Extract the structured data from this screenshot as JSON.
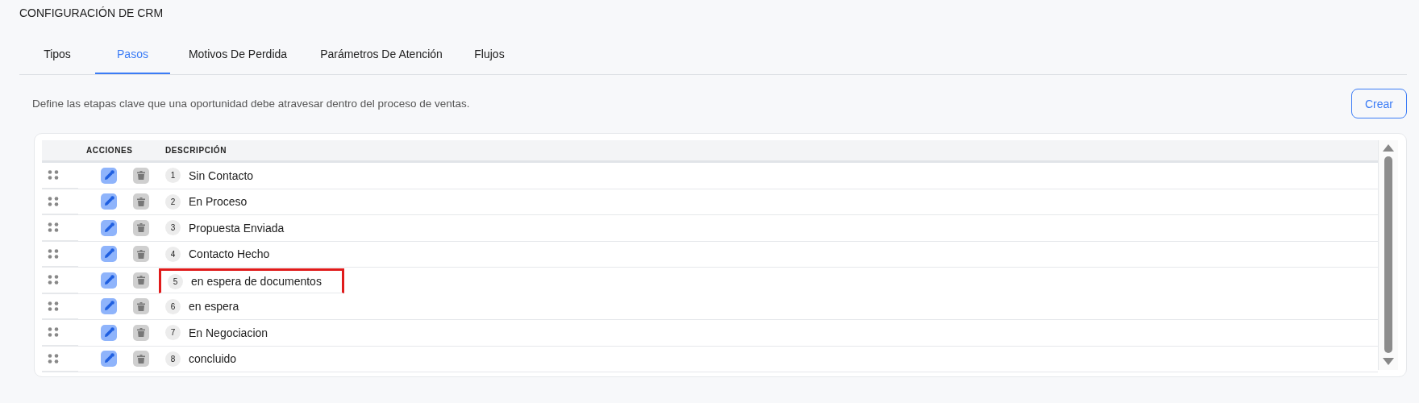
{
  "page": {
    "title": "CONFIGURACIÓN DE CRM"
  },
  "tabs": [
    {
      "label": "Tipos",
      "selected": false
    },
    {
      "label": "Pasos",
      "selected": true
    },
    {
      "label": "Motivos De Perdida",
      "selected": false
    },
    {
      "label": "Parámetros De Atención",
      "selected": false
    },
    {
      "label": "Flujos",
      "selected": false
    }
  ],
  "description": "Define las etapas clave que una oportunidad debe atravesar dentro del proceso de ventas.",
  "create_button": "Crear",
  "table": {
    "columns": [
      "ACCIONES",
      "DESCRIPCIÓN"
    ],
    "rows": [
      {
        "number": "1",
        "description": "Sin Contacto",
        "highlighted": false
      },
      {
        "number": "2",
        "description": "En Proceso",
        "highlighted": false
      },
      {
        "number": "3",
        "description": "Propuesta Enviada",
        "highlighted": false
      },
      {
        "number": "4",
        "description": "Contacto Hecho",
        "highlighted": false
      },
      {
        "number": "5",
        "description": "en espera de documentos",
        "highlighted": true
      },
      {
        "number": "6",
        "description": "en espera",
        "highlighted": false
      },
      {
        "number": "7",
        "description": "En Negociacion",
        "highlighted": false
      },
      {
        "number": "8",
        "description": "concluido",
        "highlighted": false
      }
    ]
  }
}
